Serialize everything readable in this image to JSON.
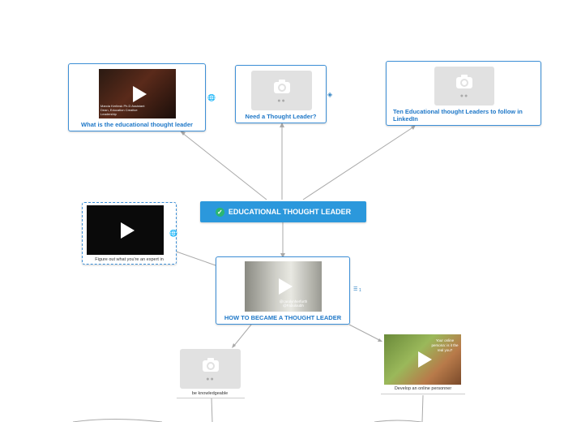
{
  "root": {
    "label": "EDUCATIONAL THOUGHT LEADER",
    "icon": "check-circle-icon"
  },
  "nodes": {
    "what_is": {
      "label": "What is the educational thought leader",
      "video_caption": "Marcia Kerlinsk Ph.D Assistant Dean, Education Creative Leadership",
      "icon": "globe-icon"
    },
    "need": {
      "label": "Need a Thought Leader?",
      "icon": "diamond-icon"
    },
    "ten": {
      "label": "Ten Educational thought Leaders to follow in LinkedIn"
    },
    "figure_out": {
      "label": "Figure out what you're an expert in",
      "icon": "globe-icon"
    },
    "how_to": {
      "label": "HOW TO BECAME A THOUGHT LEADER",
      "video_caption": "@carolynherfurth @Fabuloubh",
      "icon": "list-icon",
      "icon_count": "1"
    },
    "knowledgeable": {
      "label": "be knowledgeable"
    },
    "online": {
      "label": "Develop an online personner",
      "video_caption": "Your online persona: is it the real you?"
    }
  },
  "colors": {
    "root_bg": "#2b98dc",
    "node_border": "#3d8fd6",
    "label_text": "#1f78c8",
    "connector": "#a9a9a9"
  }
}
